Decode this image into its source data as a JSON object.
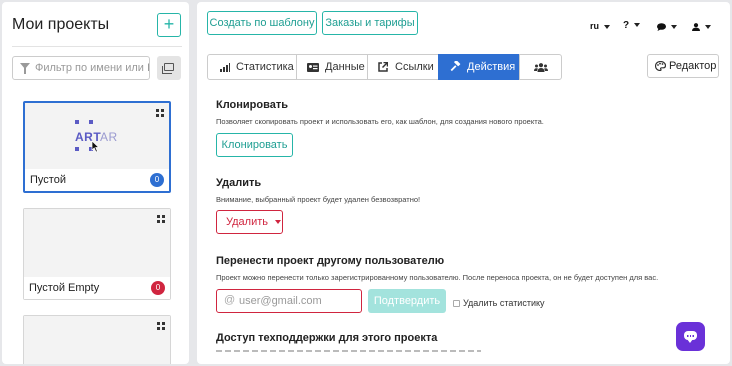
{
  "sidebar": {
    "title": "Мои проекты",
    "add_label": "+",
    "filter_placeholder": "Фильтр по имени или ID",
    "projects": [
      {
        "name": "Пустой",
        "count": "0",
        "badge_color": "#2e6fd2",
        "active": true,
        "logo": {
          "left": "ART",
          "right": "AR"
        }
      },
      {
        "name": "Пустой Empty",
        "count": "0",
        "badge_color": "#d0253f",
        "active": false
      },
      {
        "name": "",
        "count": "",
        "active": false
      }
    ]
  },
  "header": {
    "template_button": "Создать по шаблону",
    "orders_button": "Заказы и тарифы",
    "lang": "ru",
    "help": "?"
  },
  "tabs": [
    {
      "label": "Статистика",
      "icon": "bar-chart-icon",
      "active": false
    },
    {
      "label": "Данные",
      "icon": "id-card-icon",
      "active": false
    },
    {
      "label": "Ссылки",
      "icon": "external-link-icon",
      "active": false
    },
    {
      "label": "Действия",
      "icon": "hammer-icon",
      "active": true
    },
    {
      "label": "",
      "icon": "users-icon",
      "active": false
    }
  ],
  "editor_button": "Редактор",
  "clone": {
    "title": "Клонировать",
    "description": "Позволяет скопировать проект и использовать его, как шаблон, для создания нового проекта.",
    "button": "Клонировать"
  },
  "delete": {
    "title": "Удалить",
    "description": "Внимание, выбранный проект будет удален безвозвратно!",
    "button": "Удалить"
  },
  "transfer": {
    "title": "Перенести проект другому пользователю",
    "description": "Проект можно перенести только зарегистрированному пользователю. После переноса проекта, он не будет доступен для вас.",
    "email_placeholder": "user@gmail.com",
    "confirm_button": "Подтвердить",
    "checkbox_label": "Удалить статистику"
  },
  "support": {
    "title": "Доступ техподдержки для этого проекта"
  },
  "colors": {
    "accent": "#26b5a8",
    "primary": "#2e6fd2",
    "danger": "#d0253f",
    "chat": "#6a31d8"
  }
}
